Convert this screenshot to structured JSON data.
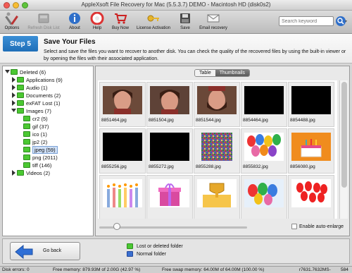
{
  "window": {
    "title": "AppleXsoft File Recovery for Mac (5.5.3.7) DEMO - Macintosh HD (disk0s2)"
  },
  "toolbar": {
    "buttons": [
      {
        "label": "Options",
        "icon": "tools-icon",
        "enabled": true
      },
      {
        "label": "Refresh Disk List",
        "icon": "disk-refresh-icon",
        "enabled": false
      },
      {
        "label": "About",
        "icon": "info-icon",
        "enabled": true
      },
      {
        "label": "Help",
        "icon": "help-lifebuoy-icon",
        "enabled": true
      },
      {
        "label": "Buy Now",
        "icon": "cart-icon",
        "enabled": true
      },
      {
        "label": "License Activation",
        "icon": "key-icon",
        "enabled": true
      },
      {
        "label": "Save",
        "icon": "save-disk-icon",
        "enabled": true
      },
      {
        "label": "Email recovery",
        "icon": "envelope-icon",
        "enabled": true
      }
    ],
    "search_placeholder": "Search keyword"
  },
  "step": {
    "badge": "Step 5",
    "title": "Save Your Files",
    "description": "Select and save the files you want to recover to another disk. You can check the quality of the recovered files by using the built-in viewer or by opening the files with their associated application."
  },
  "tree": {
    "items": [
      {
        "label": "Deleted (6)",
        "level": 0,
        "expanded": true
      },
      {
        "label": "Applications (9)",
        "level": 1,
        "expanded": false
      },
      {
        "label": "Audio (1)",
        "level": 1,
        "expanded": false
      },
      {
        "label": "Documents (2)",
        "level": 1,
        "expanded": false
      },
      {
        "label": "exFAT Lost (1)",
        "level": 1,
        "expanded": false
      },
      {
        "label": "Images (7)",
        "level": 1,
        "expanded": true
      },
      {
        "label": "cr2 (5)",
        "level": 2,
        "expanded": null
      },
      {
        "label": "gif (37)",
        "level": 2,
        "expanded": null
      },
      {
        "label": "ico (1)",
        "level": 2,
        "expanded": null
      },
      {
        "label": "jp2 (2)",
        "level": 2,
        "expanded": null
      },
      {
        "label": "jpeg (59)",
        "level": 2,
        "expanded": null,
        "selected": true
      },
      {
        "label": "png (2011)",
        "level": 2,
        "expanded": null
      },
      {
        "label": "tiff (146)",
        "level": 2,
        "expanded": null
      },
      {
        "label": "Videos (2)",
        "level": 1,
        "expanded": false
      }
    ]
  },
  "view_tabs": {
    "table": "Table",
    "thumbnails": "Thumbnails",
    "active": "thumbnails"
  },
  "thumbnails": [
    {
      "name": "8851464.jpg",
      "kind": "person"
    },
    {
      "name": "8851504.jpg",
      "kind": "person"
    },
    {
      "name": "8851544.jpg",
      "kind": "person-flipped"
    },
    {
      "name": "8854464.jpg",
      "kind": "black"
    },
    {
      "name": "8854488.jpg",
      "kind": "black"
    },
    {
      "name": "8855256.jpg",
      "kind": "black"
    },
    {
      "name": "8855272.jpg",
      "kind": "black"
    },
    {
      "name": "8855288.jpg",
      "kind": "noise"
    },
    {
      "name": "8855832.jpg",
      "kind": "balloons"
    },
    {
      "name": "8856080.jpg",
      "kind": "cake"
    },
    {
      "name": "",
      "kind": "candles"
    },
    {
      "name": "",
      "kind": "gifts"
    },
    {
      "name": "",
      "kind": "trophy"
    },
    {
      "name": "",
      "kind": "balloons-sky"
    },
    {
      "name": "",
      "kind": "balloons-red"
    }
  ],
  "thumb_size_level": 0.15,
  "auto_enlarge_label": "Enable auto-enlarge",
  "bottom": {
    "go_back": "Go back",
    "legend": [
      {
        "label": "Lost or deleted folder",
        "color": "#4bc832"
      },
      {
        "label": "Normal folder",
        "color": "#3a6fd0"
      }
    ]
  },
  "status": {
    "disk_errors": "Disk errors: 0",
    "free_memory": "Free memory: 879.93M of 2.00G (42.97 %)",
    "free_swap": "Free swap memory: 64.00M of 64.00M (100.00 %)",
    "right_code": "r7631.7632MS-",
    "right_num": "584"
  }
}
